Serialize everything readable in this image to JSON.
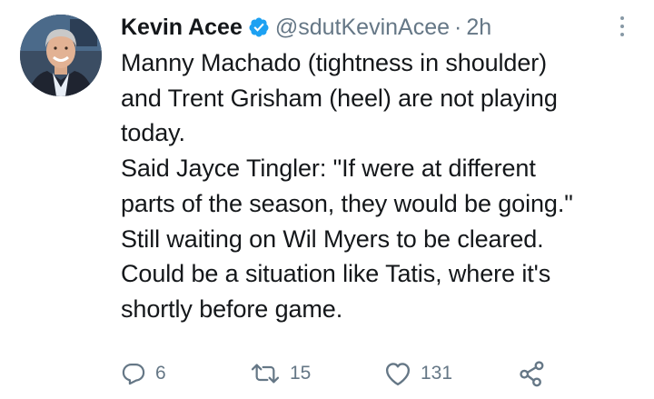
{
  "tweet": {
    "author": {
      "name": "Kevin Acee",
      "handle": "@sdutKevinAcee",
      "verified": true,
      "avatar": "avatar-photo"
    },
    "separator": "·",
    "time": "2h",
    "menu_icon": "more-vertical-icon",
    "lines": [
      "Manny Machado (tightness in shoulder)",
      "and Trent Grisham (heel) are not playing",
      "today.",
      "Said Jayce Tingler: \"If were at different",
      "parts of the season, they would be going.\"",
      "Still waiting on Wil Myers to be cleared.",
      "Could be a situation like Tatis, where it's",
      "shortly before game."
    ],
    "actions": {
      "reply": {
        "icon": "reply-icon",
        "count": "6"
      },
      "retweet": {
        "icon": "retweet-icon",
        "count": "15"
      },
      "like": {
        "icon": "heart-icon",
        "count": "131"
      },
      "share": {
        "icon": "share-icon"
      }
    }
  },
  "colors": {
    "text": "#14171a",
    "secondary": "#657786",
    "verified": "#1da1f2",
    "background": "#ffffff"
  }
}
